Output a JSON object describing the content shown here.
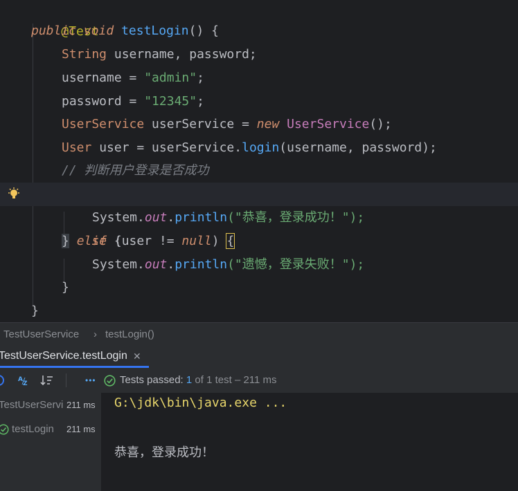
{
  "editor": {
    "annotation": "@Test",
    "sig": {
      "mod": "public",
      "ret": "void",
      "name": "testLogin",
      "rest": "() {"
    },
    "decl": {
      "type": "String",
      "rest": " username, password;"
    },
    "assign1": {
      "lhs": "username = ",
      "val": "\"admin\"",
      "end": ";"
    },
    "assign2": {
      "lhs": "password = ",
      "val": "\"12345\"",
      "end": ";"
    },
    "svc": {
      "type": "UserService",
      "mid": " userService = ",
      "new": "new",
      "ctor": " UserService",
      "end": "();"
    },
    "usr": {
      "type": "User",
      "mid": " user = userService.",
      "call": "login",
      "end": "(username, password);"
    },
    "comment": "// 判断用户登录是否成功",
    "ifline": {
      "kw": "if",
      "mid": " (user != ",
      "nul": "null",
      "end": ") ",
      "brace": "{"
    },
    "print1": {
      "cls": "System.",
      "fld": "out",
      "dot": ".",
      "fn": "println",
      "arg": "(\"恭喜，登录成功！\");"
    },
    "elseline": {
      "b1": "}",
      "sp": " ",
      "kw": "else",
      "b2": " {"
    },
    "print2": {
      "cls": "System.",
      "fld": "out",
      "dot": ".",
      "fn": "println",
      "arg": "(\"遗憾，登录失败！\");"
    },
    "close1": "}",
    "close2": "}"
  },
  "breadcrumb": {
    "class_name": "TestUserService",
    "sep": "›",
    "method": "testLogin()"
  },
  "run_tab": {
    "label": "TestUserService.testLogin",
    "close": "✕"
  },
  "toolbar": {
    "more": "•••",
    "status_label": "Tests passed:",
    "status_count": "1",
    "status_rest": "of 1 test – 211 ms"
  },
  "tree": [
    {
      "label": "TestUserServi",
      "time": "211 ms"
    },
    {
      "label": "testLogin",
      "time": "211 ms"
    }
  ],
  "console": {
    "cmd": "G:\\jdk\\bin\\java.exe ...",
    "output": "恭喜，登录成功！"
  },
  "colors": {
    "accent": "#3574f0",
    "pass": "#5fb865"
  }
}
